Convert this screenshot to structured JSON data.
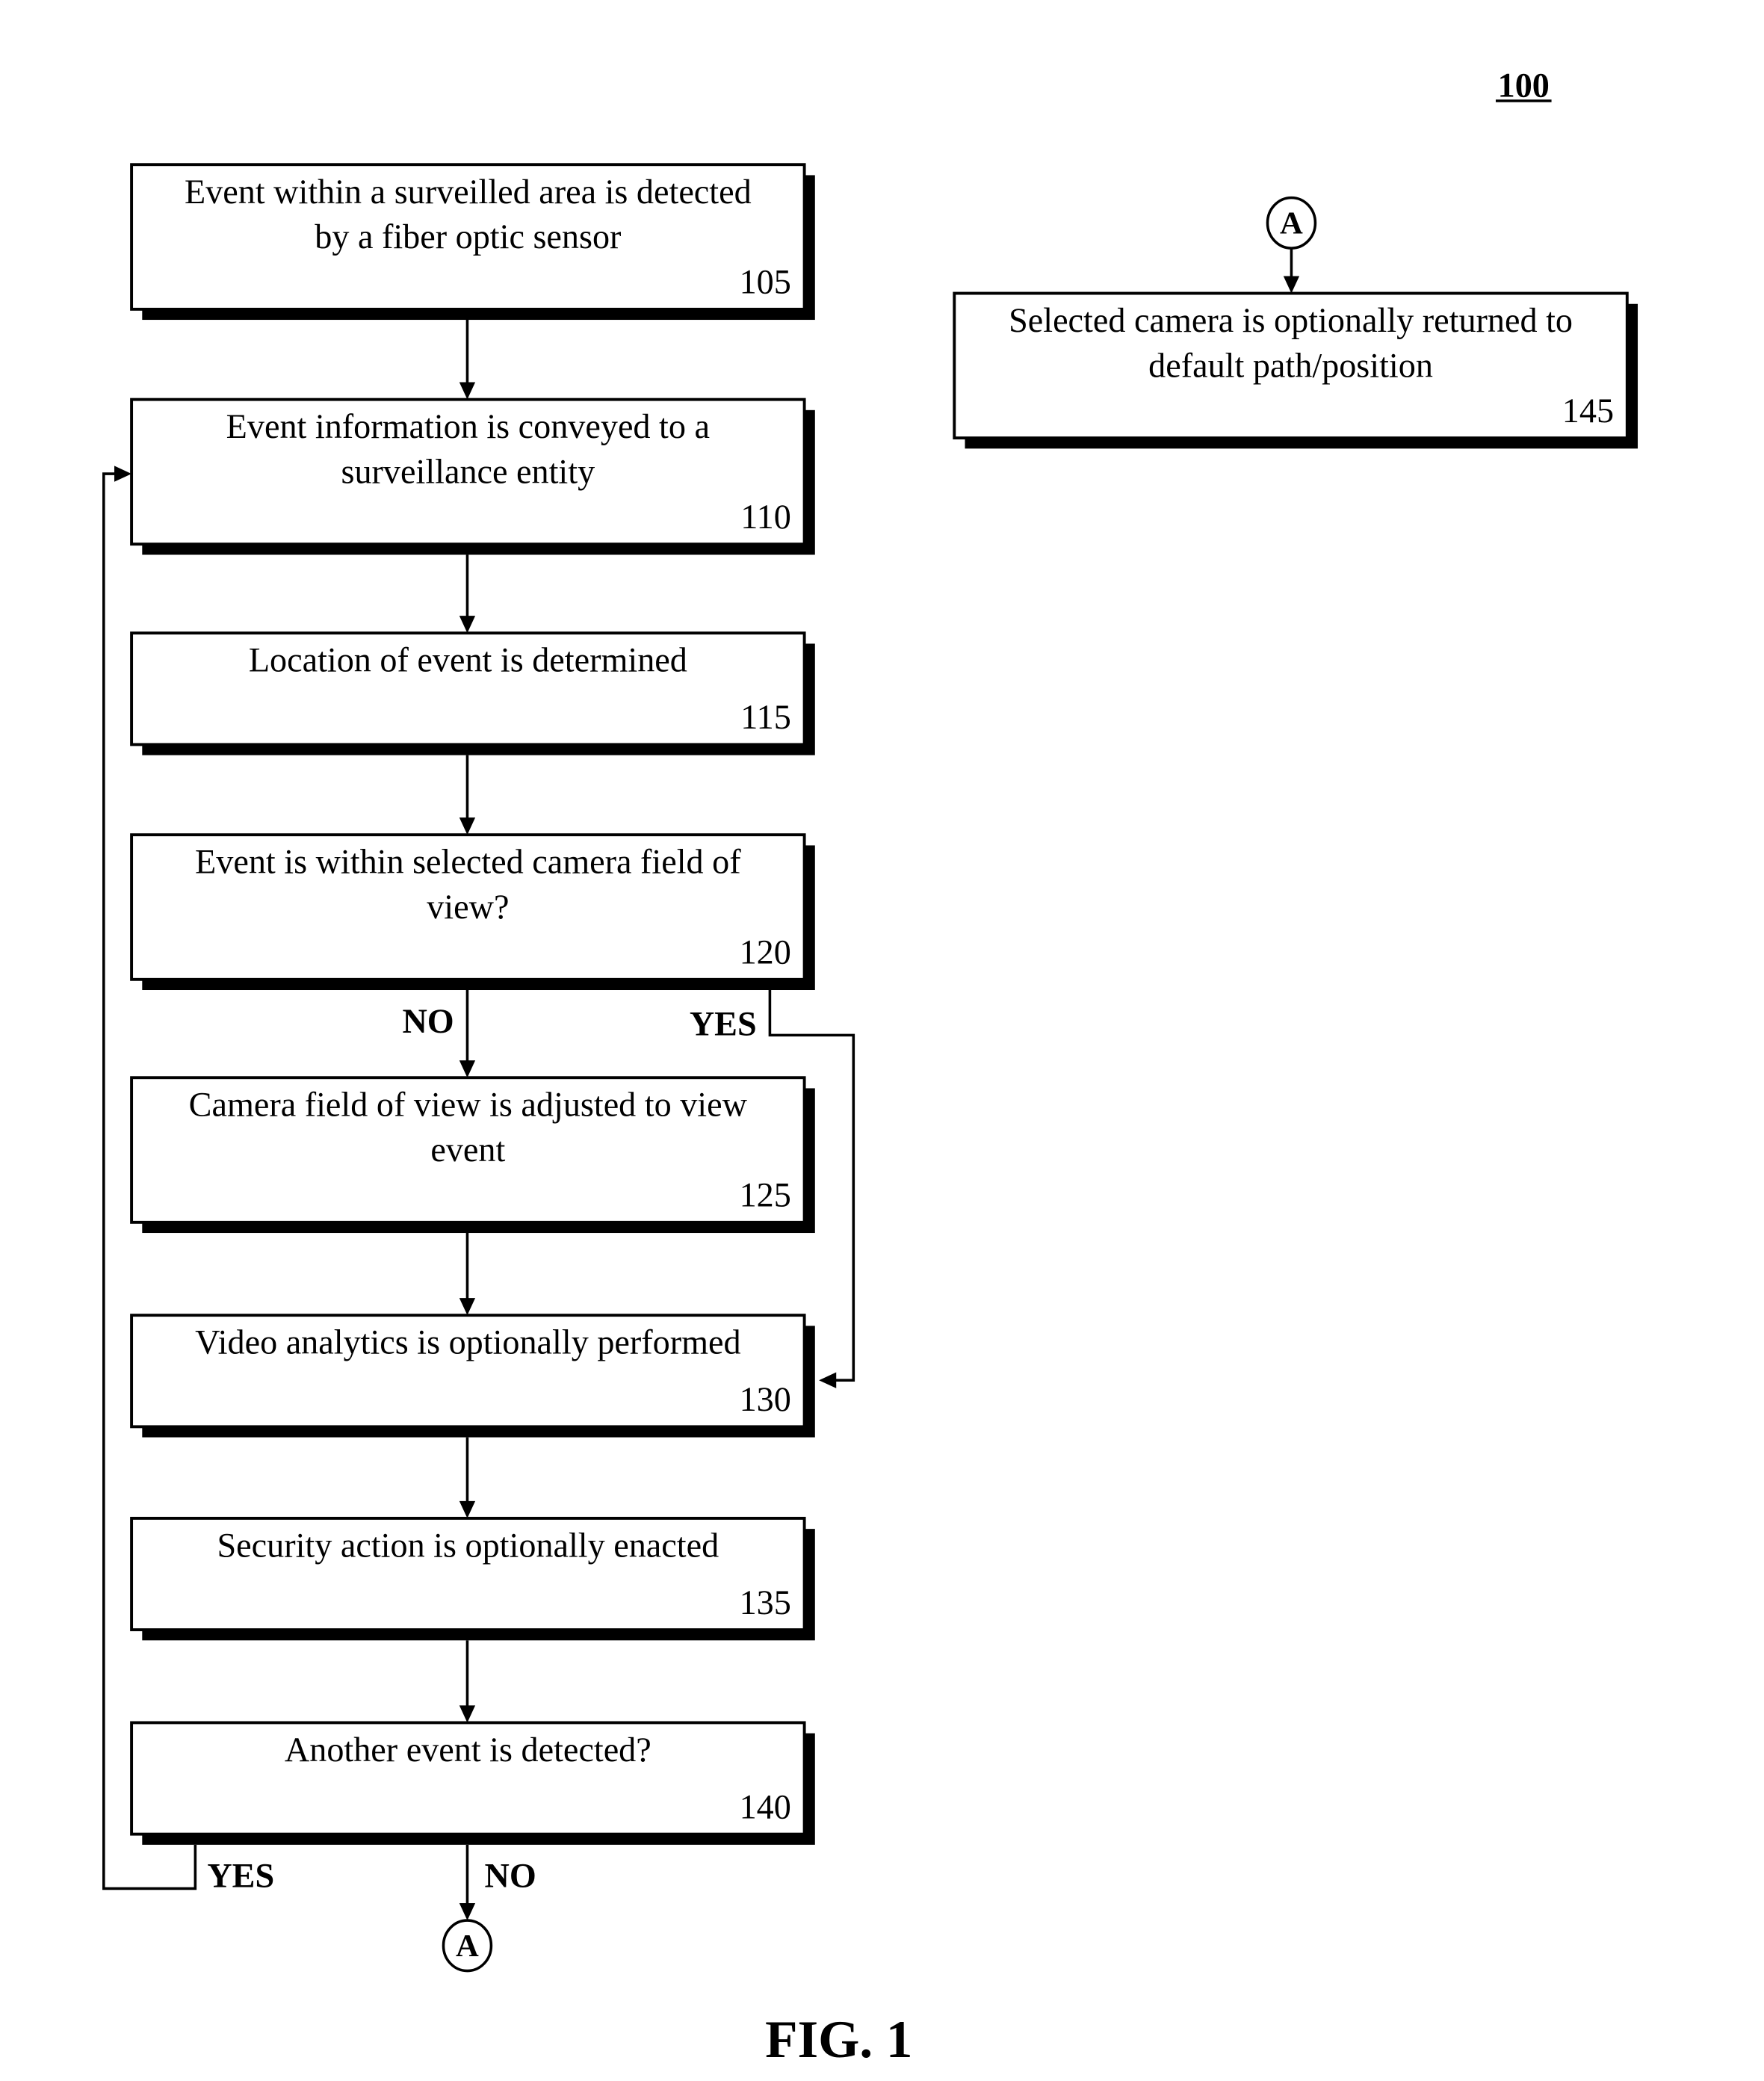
{
  "figure": {
    "reference_number": "100",
    "caption": "FIG. 1"
  },
  "steps": [
    {
      "id": "105",
      "lines": [
        "Event within a surveilled area is detected",
        "by a fiber optic sensor"
      ]
    },
    {
      "id": "110",
      "lines": [
        "Event information is conveyed to a",
        "surveillance entity"
      ]
    },
    {
      "id": "115",
      "lines": [
        "Location of event is determined"
      ]
    },
    {
      "id": "120",
      "lines": [
        "Event is within selected camera field of",
        "view?"
      ]
    },
    {
      "id": "125",
      "lines": [
        "Camera field of view is adjusted to view",
        "event"
      ]
    },
    {
      "id": "130",
      "lines": [
        "Video analytics is optionally performed"
      ]
    },
    {
      "id": "135",
      "lines": [
        "Security action is optionally enacted"
      ]
    },
    {
      "id": "140",
      "lines": [
        "Another event is detected?"
      ]
    },
    {
      "id": "145",
      "lines": [
        "Selected camera is optionally returned to",
        "default path/position"
      ]
    }
  ],
  "branch_labels": {
    "decision_120_no": "NO",
    "decision_120_yes": "YES",
    "decision_140_yes": "YES",
    "decision_140_no": "NO"
  },
  "connectors": {
    "off_page_out": "A",
    "off_page_in": "A"
  }
}
